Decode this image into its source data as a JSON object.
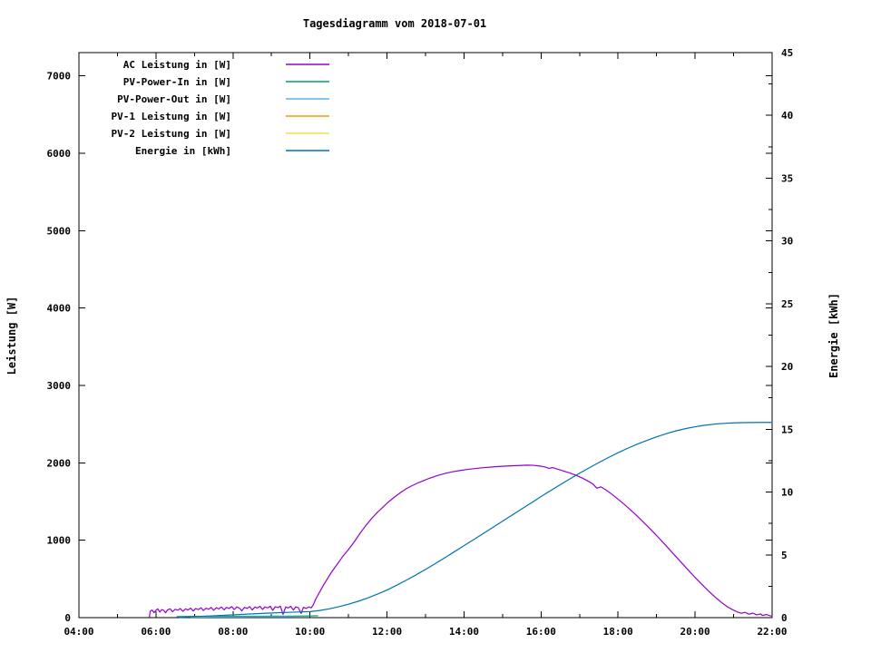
{
  "window_title": "Tagesdiagramm vom 2018-07-01",
  "chart_data": {
    "type": "line",
    "title": "Tagesdiagramm vom 2018-07-01",
    "xlabel": "",
    "ylabel_left": "Leistung [W]",
    "ylabel_right": "Energie [kWh]",
    "xlim_hours": [
      4,
      22
    ],
    "x_major_ticks": [
      {
        "hour": 4,
        "label": "04:00"
      },
      {
        "hour": 6,
        "label": "06:00"
      },
      {
        "hour": 8,
        "label": "08:00"
      },
      {
        "hour": 10,
        "label": "10:00"
      },
      {
        "hour": 12,
        "label": "12:00"
      },
      {
        "hour": 14,
        "label": "14:00"
      },
      {
        "hour": 16,
        "label": "16:00"
      },
      {
        "hour": 18,
        "label": "18:00"
      },
      {
        "hour": 20,
        "label": "20:00"
      },
      {
        "hour": 22,
        "label": "22:00"
      }
    ],
    "x_minor_hours": [
      5,
      7,
      9,
      11,
      13,
      15,
      17,
      19,
      21
    ],
    "ylim_left": [
      0,
      7300
    ],
    "y_major_ticks_left": [
      0,
      1000,
      2000,
      3000,
      4000,
      5000,
      6000,
      7000
    ],
    "ylim_right": [
      0,
      45
    ],
    "y_major_ticks_right": [
      0,
      5,
      10,
      15,
      20,
      25,
      30,
      35,
      40,
      45
    ],
    "y_minor_ticks_right": [
      2.5,
      7.5,
      12.5,
      17.5,
      22.5,
      27.5,
      32.5,
      37.5,
      42.5
    ],
    "grid": false,
    "legend_position": "top-left-inside",
    "axis_color": "#000000",
    "series": [
      {
        "name": "AC Leistung in [W]",
        "color": "#9400d3",
        "axis": "left",
        "points": [
          [
            5.83,
            8
          ],
          [
            5.85,
            82
          ],
          [
            5.9,
            98
          ],
          [
            5.95,
            64
          ],
          [
            6.0,
            96
          ],
          [
            6.05,
            112
          ],
          [
            6.1,
            72
          ],
          [
            6.15,
            104
          ],
          [
            6.2,
            94
          ],
          [
            6.25,
            62
          ],
          [
            6.3,
            101
          ],
          [
            6.37,
            114
          ],
          [
            6.43,
            76
          ],
          [
            6.5,
            108
          ],
          [
            6.57,
            96
          ],
          [
            6.63,
            118
          ],
          [
            6.7,
            82
          ],
          [
            6.77,
            113
          ],
          [
            6.83,
            99
          ],
          [
            6.9,
            122
          ],
          [
            6.97,
            86
          ],
          [
            7.03,
            118
          ],
          [
            7.1,
            104
          ],
          [
            7.17,
            128
          ],
          [
            7.23,
            92
          ],
          [
            7.3,
            122
          ],
          [
            7.37,
            108
          ],
          [
            7.43,
            132
          ],
          [
            7.5,
            96
          ],
          [
            7.57,
            128
          ],
          [
            7.63,
            113
          ],
          [
            7.7,
            138
          ],
          [
            7.77,
            100
          ],
          [
            7.83,
            132
          ],
          [
            7.9,
            118
          ],
          [
            7.97,
            142
          ],
          [
            8.03,
            104
          ],
          [
            8.1,
            138
          ],
          [
            8.17,
            122
          ],
          [
            8.23,
            88
          ],
          [
            8.3,
            133
          ],
          [
            8.37,
            119
          ],
          [
            8.43,
            143
          ],
          [
            8.5,
            99
          ],
          [
            8.57,
            138
          ],
          [
            8.63,
            124
          ],
          [
            8.7,
            146
          ],
          [
            8.77,
            106
          ],
          [
            8.83,
            139
          ],
          [
            8.9,
            126
          ],
          [
            8.97,
            147
          ],
          [
            9.03,
            94
          ],
          [
            9.1,
            141
          ],
          [
            9.17,
            129
          ],
          [
            9.23,
            149
          ],
          [
            9.3,
            42
          ],
          [
            9.37,
            139
          ],
          [
            9.43,
            124
          ],
          [
            9.5,
            146
          ],
          [
            9.57,
            98
          ],
          [
            9.63,
            139
          ],
          [
            9.7,
            128
          ],
          [
            9.77,
            54
          ],
          [
            9.83,
            134
          ],
          [
            9.9,
            119
          ],
          [
            9.97,
            139
          ],
          [
            10.03,
            126
          ],
          [
            10.08,
            160
          ],
          [
            10.15,
            240
          ],
          [
            10.25,
            330
          ],
          [
            10.35,
            420
          ],
          [
            10.45,
            500
          ],
          [
            10.55,
            580
          ],
          [
            10.65,
            650
          ],
          [
            10.75,
            720
          ],
          [
            10.85,
            790
          ],
          [
            11.0,
            880
          ],
          [
            11.15,
            980
          ],
          [
            11.3,
            1090
          ],
          [
            11.45,
            1190
          ],
          [
            11.6,
            1280
          ],
          [
            11.75,
            1360
          ],
          [
            11.9,
            1430
          ],
          [
            12.05,
            1500
          ],
          [
            12.2,
            1560
          ],
          [
            12.35,
            1615
          ],
          [
            12.5,
            1665
          ],
          [
            12.65,
            1705
          ],
          [
            12.8,
            1740
          ],
          [
            12.95,
            1770
          ],
          [
            13.1,
            1800
          ],
          [
            13.3,
            1835
          ],
          [
            13.5,
            1862
          ],
          [
            13.7,
            1884
          ],
          [
            13.9,
            1901
          ],
          [
            14.1,
            1915
          ],
          [
            14.3,
            1927
          ],
          [
            14.5,
            1937
          ],
          [
            14.7,
            1945
          ],
          [
            14.9,
            1952
          ],
          [
            15.1,
            1958
          ],
          [
            15.3,
            1963
          ],
          [
            15.5,
            1967
          ],
          [
            15.65,
            1970
          ],
          [
            15.8,
            1968
          ],
          [
            15.95,
            1960
          ],
          [
            16.1,
            1947
          ],
          [
            16.2,
            1928
          ],
          [
            16.3,
            1938
          ],
          [
            16.45,
            1915
          ],
          [
            16.6,
            1892
          ],
          [
            16.75,
            1868
          ],
          [
            16.9,
            1840
          ],
          [
            17.05,
            1808
          ],
          [
            17.2,
            1770
          ],
          [
            17.35,
            1725
          ],
          [
            17.45,
            1672
          ],
          [
            17.55,
            1690
          ],
          [
            17.7,
            1645
          ],
          [
            17.85,
            1590
          ],
          [
            18.0,
            1530
          ],
          [
            18.15,
            1468
          ],
          [
            18.3,
            1402
          ],
          [
            18.45,
            1333
          ],
          [
            18.6,
            1262
          ],
          [
            18.75,
            1188
          ],
          [
            18.9,
            1112
          ],
          [
            19.05,
            1034
          ],
          [
            19.2,
            954
          ],
          [
            19.35,
            872
          ],
          [
            19.5,
            790
          ],
          [
            19.65,
            708
          ],
          [
            19.8,
            626
          ],
          [
            19.95,
            546
          ],
          [
            20.1,
            468
          ],
          [
            20.25,
            392
          ],
          [
            20.4,
            320
          ],
          [
            20.55,
            252
          ],
          [
            20.7,
            190
          ],
          [
            20.85,
            136
          ],
          [
            21.0,
            96
          ],
          [
            21.1,
            72
          ],
          [
            21.2,
            56
          ],
          [
            21.3,
            68
          ],
          [
            21.4,
            44
          ],
          [
            21.5,
            58
          ],
          [
            21.6,
            36
          ],
          [
            21.7,
            48
          ],
          [
            21.75,
            28
          ],
          [
            21.85,
            40
          ],
          [
            21.95,
            24
          ],
          [
            22.0,
            18
          ]
        ]
      },
      {
        "name": "PV-Power-In in [W]",
        "color": "#009e73",
        "axis": "left",
        "points": [
          [
            6.55,
            14
          ],
          [
            7.0,
            16
          ],
          [
            7.5,
            16
          ],
          [
            8.0,
            18
          ],
          [
            8.5,
            18
          ],
          [
            9.0,
            20
          ],
          [
            9.5,
            20
          ],
          [
            10.0,
            22
          ],
          [
            10.2,
            24
          ]
        ]
      },
      {
        "name": "PV-Power-Out in [W]",
        "color": "#56b4e9",
        "axis": "left",
        "points": [
          [
            6.9,
            6
          ],
          [
            7.5,
            8
          ],
          [
            8.0,
            8
          ],
          [
            8.5,
            10
          ],
          [
            9.0,
            10
          ],
          [
            9.6,
            10
          ]
        ]
      },
      {
        "name": "PV-1 Leistung in [W]",
        "color": "#e69f00",
        "axis": "left",
        "points": []
      },
      {
        "name": "PV-2 Leistung in [W]",
        "color": "#f0e442",
        "axis": "left",
        "points": []
      },
      {
        "name": "Energie in [kWh]",
        "color": "#0072b2",
        "axis": "right",
        "points": [
          [
            6.62,
            0.02
          ],
          [
            7.0,
            0.08
          ],
          [
            7.5,
            0.15
          ],
          [
            8.0,
            0.22
          ],
          [
            8.5,
            0.3
          ],
          [
            9.0,
            0.37
          ],
          [
            9.5,
            0.43
          ],
          [
            10.0,
            0.48
          ],
          [
            10.25,
            0.57
          ],
          [
            10.5,
            0.7
          ],
          [
            10.75,
            0.87
          ],
          [
            11.0,
            1.07
          ],
          [
            11.25,
            1.3
          ],
          [
            11.5,
            1.57
          ],
          [
            11.75,
            1.87
          ],
          [
            12.0,
            2.2
          ],
          [
            12.25,
            2.58
          ],
          [
            12.5,
            2.98
          ],
          [
            12.75,
            3.4
          ],
          [
            13.0,
            3.84
          ],
          [
            13.25,
            4.3
          ],
          [
            13.5,
            4.77
          ],
          [
            13.75,
            5.25
          ],
          [
            14.0,
            5.73
          ],
          [
            14.25,
            6.21
          ],
          [
            14.5,
            6.7
          ],
          [
            14.75,
            7.19
          ],
          [
            15.0,
            7.68
          ],
          [
            15.25,
            8.17
          ],
          [
            15.5,
            8.66
          ],
          [
            15.75,
            9.15
          ],
          [
            16.0,
            9.64
          ],
          [
            16.25,
            10.12
          ],
          [
            16.5,
            10.59
          ],
          [
            16.75,
            11.05
          ],
          [
            17.0,
            11.5
          ],
          [
            17.25,
            11.93
          ],
          [
            17.5,
            12.35
          ],
          [
            17.75,
            12.75
          ],
          [
            18.0,
            13.13
          ],
          [
            18.25,
            13.49
          ],
          [
            18.5,
            13.82
          ],
          [
            18.75,
            14.12
          ],
          [
            19.0,
            14.4
          ],
          [
            19.25,
            14.65
          ],
          [
            19.5,
            14.87
          ],
          [
            19.75,
            15.05
          ],
          [
            20.0,
            15.2
          ],
          [
            20.25,
            15.32
          ],
          [
            20.5,
            15.41
          ],
          [
            20.75,
            15.47
          ],
          [
            21.0,
            15.51
          ],
          [
            21.25,
            15.53
          ],
          [
            21.5,
            15.54
          ],
          [
            21.75,
            15.55
          ],
          [
            22.0,
            15.55
          ]
        ]
      }
    ]
  }
}
